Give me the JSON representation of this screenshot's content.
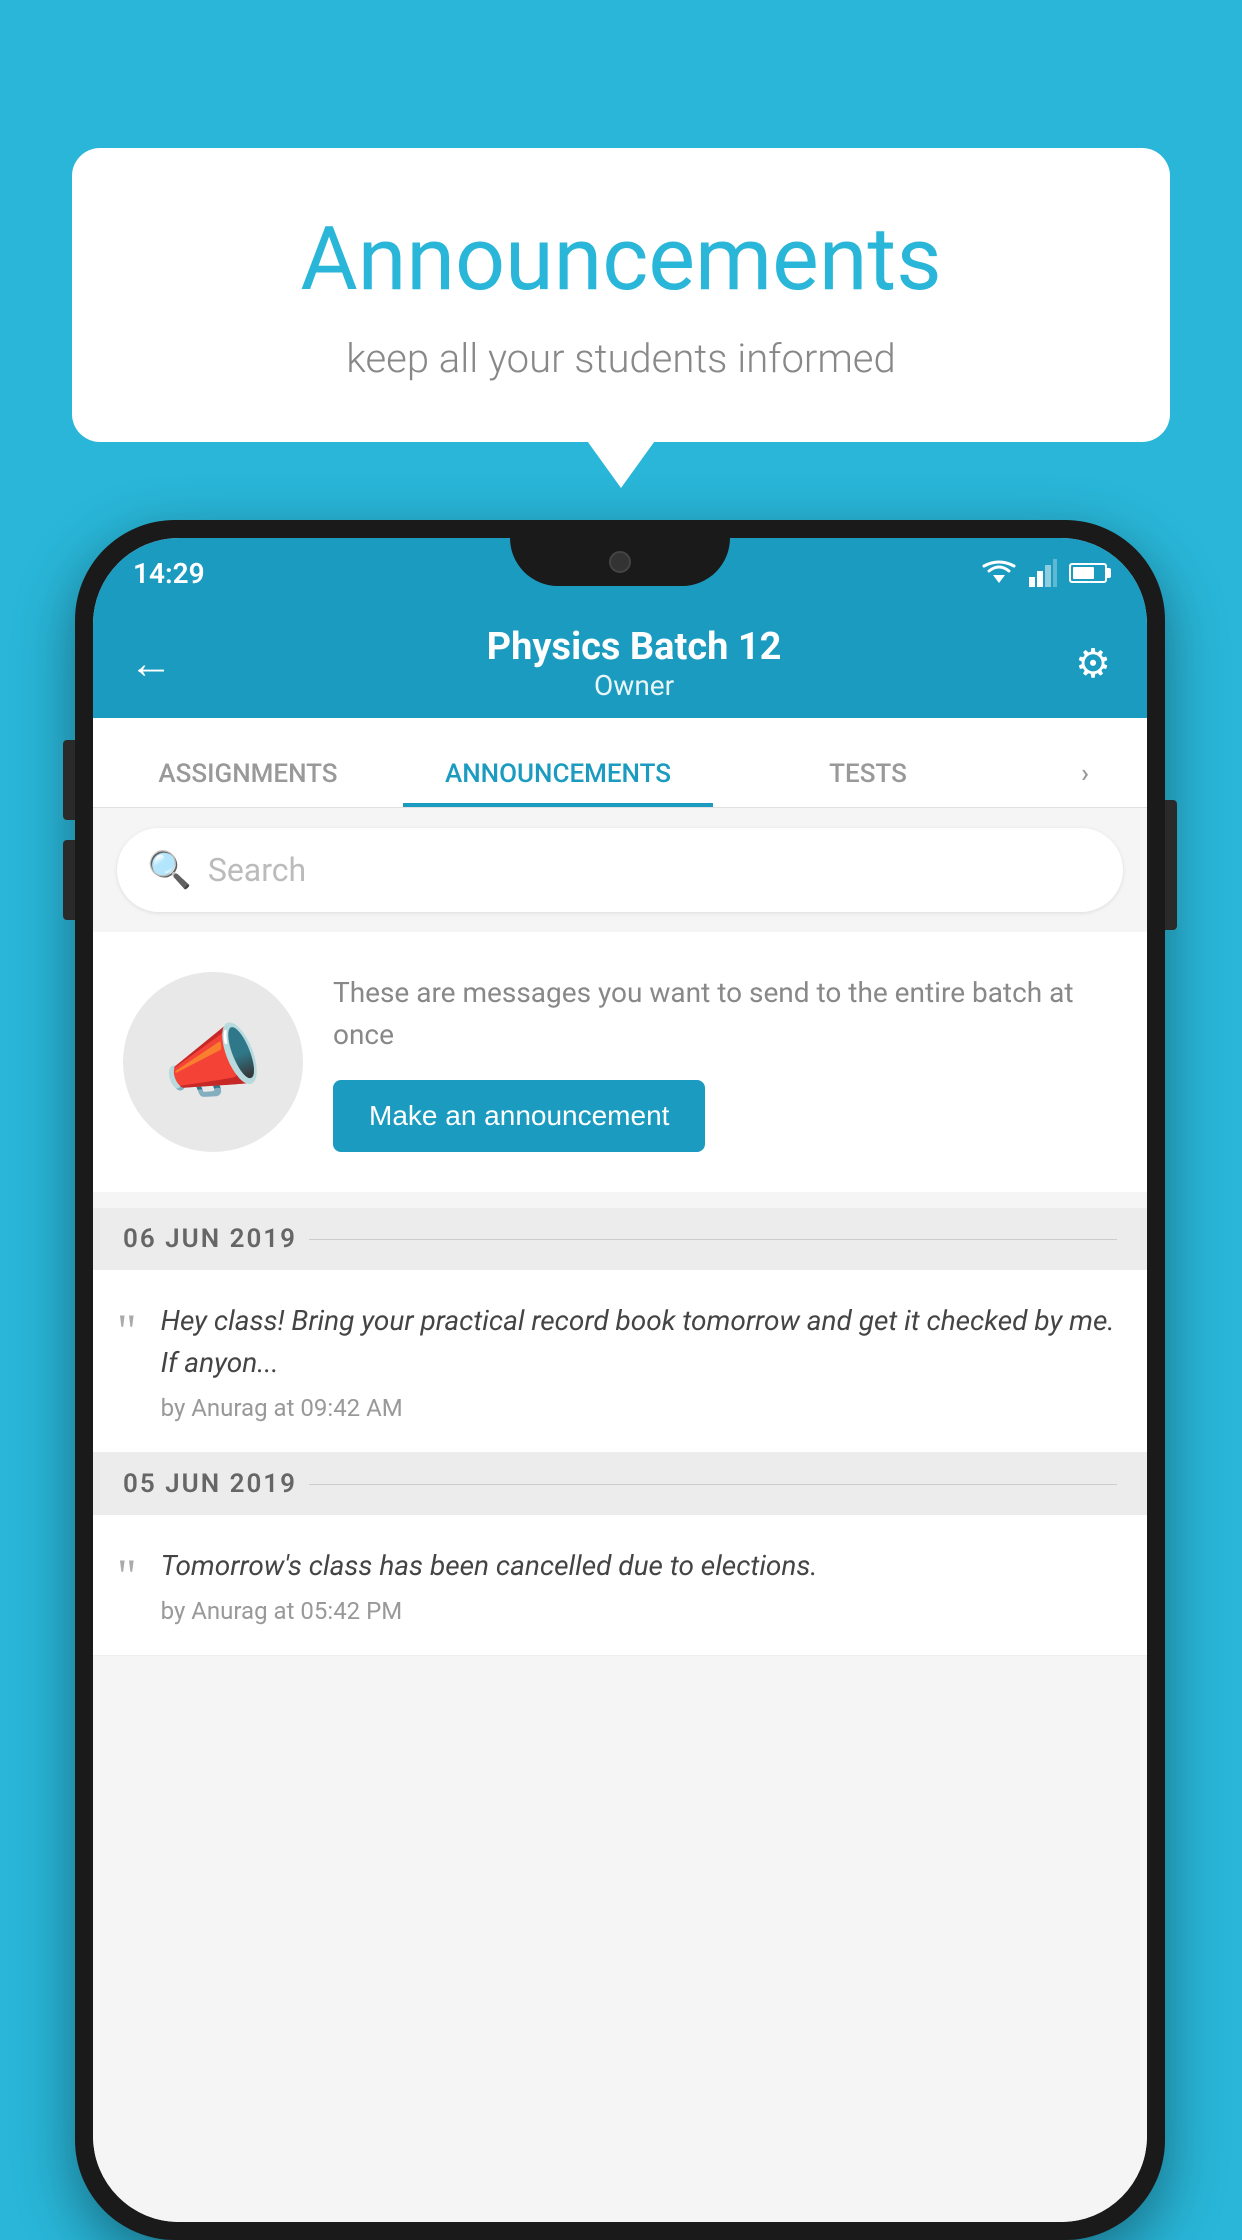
{
  "background_color": "#29b6d8",
  "speech_bubble": {
    "title": "Announcements",
    "subtitle": "keep all your students informed"
  },
  "status_bar": {
    "time": "14:29"
  },
  "app_bar": {
    "title": "Physics Batch 12",
    "subtitle": "Owner",
    "back_label": "←",
    "settings_label": "⚙"
  },
  "tabs": [
    {
      "label": "ASSIGNMENTS",
      "active": false
    },
    {
      "label": "ANNOUNCEMENTS",
      "active": true
    },
    {
      "label": "TESTS",
      "active": false
    },
    {
      "label": "›",
      "active": false
    }
  ],
  "search": {
    "placeholder": "Search"
  },
  "promo": {
    "description": "These are messages you want to send to the entire batch at once",
    "button_label": "Make an announcement"
  },
  "announcements": [
    {
      "date": "06  JUN  2019",
      "text": "Hey class! Bring your practical record book tomorrow and get it checked by me. If anyon...",
      "meta": "by Anurag at 09:42 AM"
    },
    {
      "date": "05  JUN  2019",
      "text": "Tomorrow's class has been cancelled due to elections.",
      "meta": "by Anurag at 05:42 PM"
    }
  ]
}
